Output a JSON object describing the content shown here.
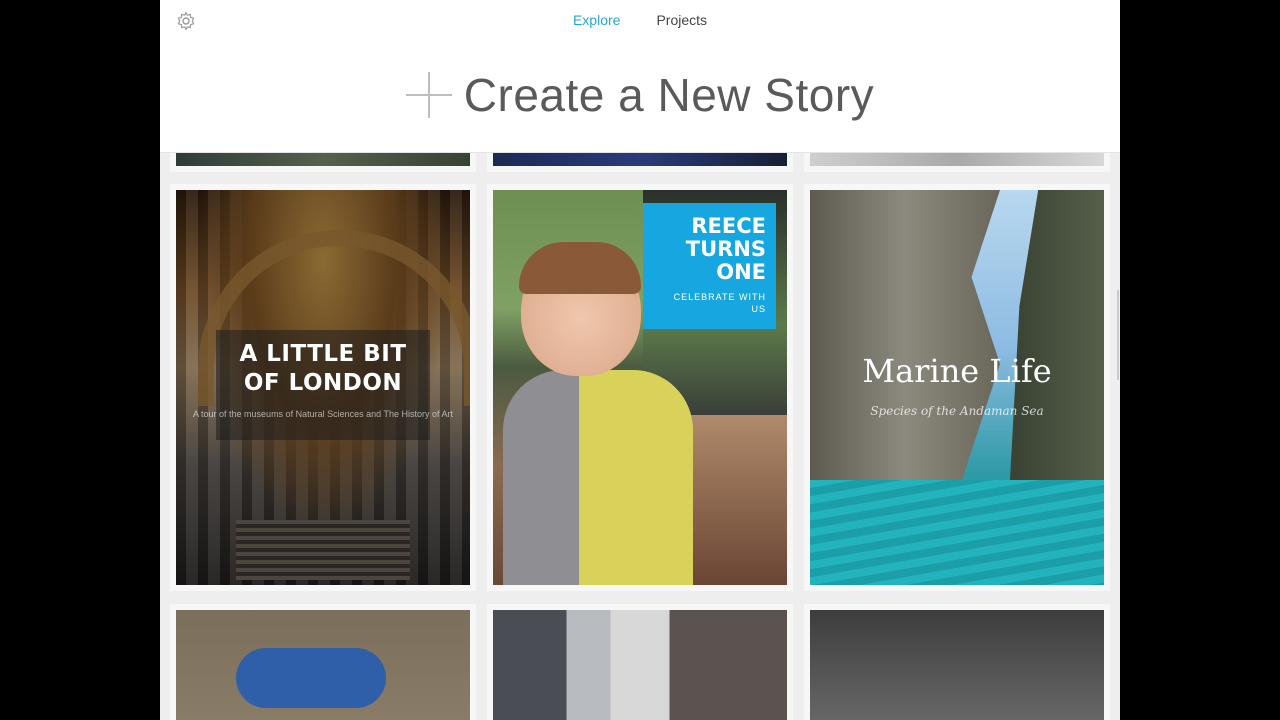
{
  "header": {
    "settings_icon": "gear-icon",
    "tabs": [
      {
        "label": "Explore",
        "active": true
      },
      {
        "label": "Projects",
        "active": false
      }
    ],
    "create_icon": "plus-icon",
    "create_label": "Create a New Story",
    "accent_color": "#2aa6cf"
  },
  "stories": [
    {
      "title": "A LITTLE BIT OF LONDON",
      "subtitle": "A tour of the museums of Natural Sciences and The History of Art"
    },
    {
      "title": "REECE TURNS ONE",
      "subtitle": "CELEBRATE WITH US",
      "badge_color": "#16a7e0"
    },
    {
      "title": "Marine Life",
      "subtitle": "Species of the Andaman Sea"
    }
  ]
}
